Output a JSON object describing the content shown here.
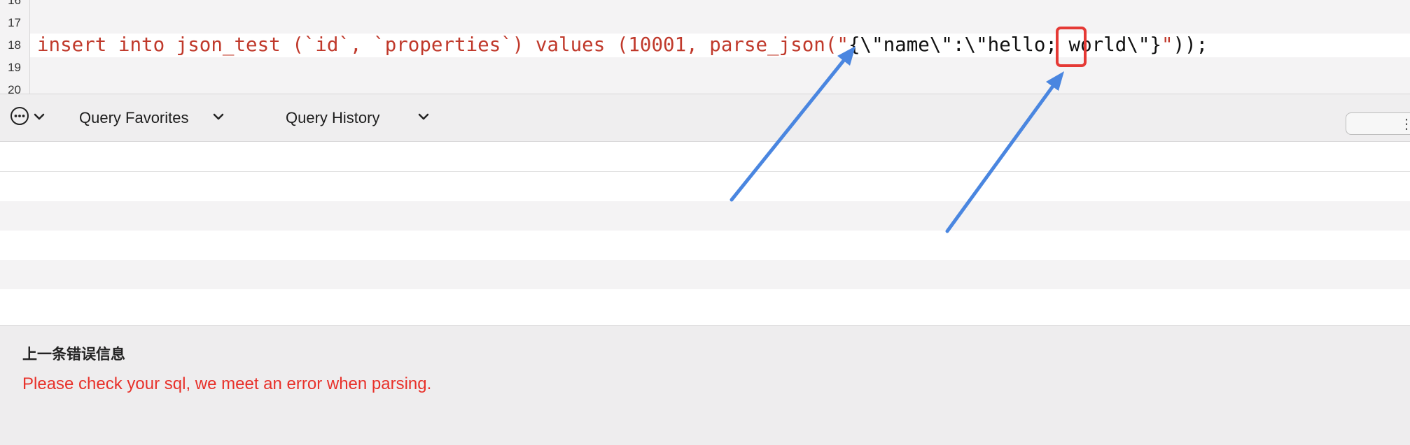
{
  "editor": {
    "line_numbers": [
      "16",
      "17",
      "18",
      "19",
      "20"
    ],
    "code": {
      "part1": "insert into json_test (`id`, `properties`) values (10001, parse_json(\"",
      "part2": "{\\\"name\\\":\\\"",
      "part3": "hello; world",
      "part4": "\\\"}",
      "part5": "\"",
      "part6": "));"
    }
  },
  "toolbar": {
    "more_icon": "ellipsis-circle-icon",
    "favorites_label": "Query Favorites",
    "history_label": "Query History",
    "right_control_glyph": "⋮"
  },
  "error_panel": {
    "title": "上一条错误信息",
    "message": "Please check your sql, we meet an error when parsing."
  },
  "colors": {
    "code_red": "#c0392b",
    "error_red": "#e8312a",
    "annotation_blue": "#4a86e0",
    "highlight_red": "#e53935"
  }
}
